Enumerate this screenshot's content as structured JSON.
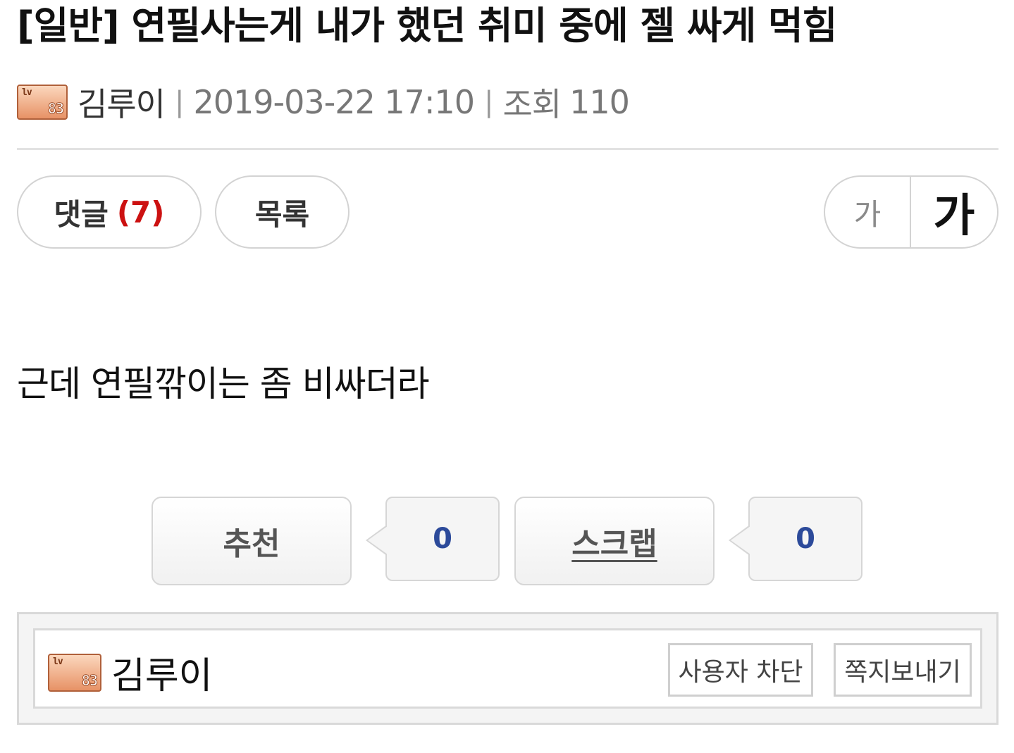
{
  "post": {
    "title": "[일반] 연필사는게 내가 했던 취미 중에 젤 싸게 먹힘",
    "author": "김루이",
    "author_level": "83",
    "level_prefix": "lv",
    "datetime": "2019-03-22 17:10",
    "views_label": "조회",
    "views": "110",
    "separator": "|",
    "content": "근데 연필깎이는 좀 비싸더라"
  },
  "toolbar": {
    "comments_label": "댓글",
    "comments_count": "(7)",
    "list_label": "목록",
    "font_small": "가",
    "font_large": "가"
  },
  "actions": {
    "recommend_label": "추천",
    "recommend_count": "0",
    "scrap_label": "스크랩",
    "scrap_count": "0"
  },
  "author_box": {
    "name": "김루이",
    "block_label": "사용자 차단",
    "message_label": "쪽지보내기"
  },
  "colors": {
    "comment_count": "#cc1111",
    "vote_count": "#2c4a9a",
    "badge_fill": "#e79266"
  }
}
